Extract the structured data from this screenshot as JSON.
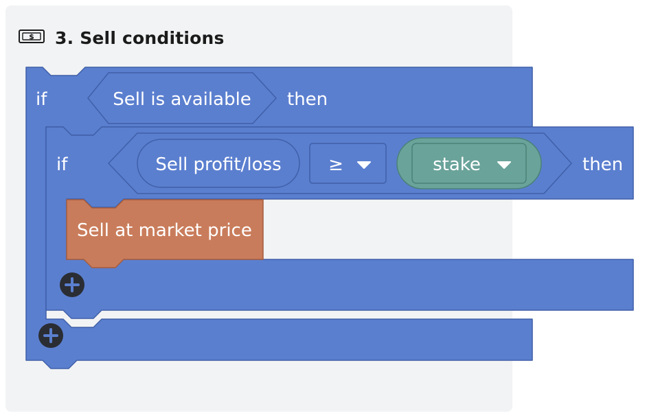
{
  "header": {
    "icon": "banknote-icon",
    "title": "3. Sell conditions"
  },
  "blocks": {
    "outer_if": {
      "keyword_if": "if",
      "condition": "Sell is available",
      "keyword_then": "then"
    },
    "inner_if": {
      "keyword_if": "if",
      "left_operand": "Sell profit/loss",
      "operator": "≥",
      "right_operand": "stake",
      "keyword_then": "then"
    },
    "action": "Sell at market price"
  },
  "colors": {
    "if_block": "#5b7fcf",
    "if_block_border": "#3f5fa8",
    "action_block": "#c97c5b",
    "stake_block": "#6aa39a",
    "add_button": "#2a2d33",
    "panel_bg": "#f2f3f4"
  }
}
